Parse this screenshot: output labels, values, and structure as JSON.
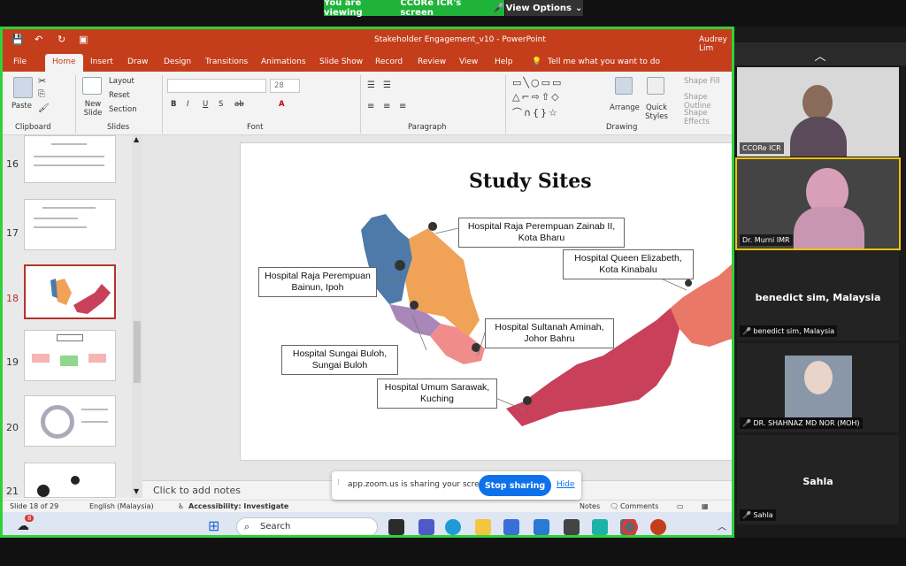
{
  "zoom": {
    "viewing_text": "You are viewing",
    "viewing_name": "CCORe ICR's screen",
    "view_options": "View Options",
    "share_msg": "app.zoom.us is sharing your screen.",
    "stop_label": "Stop sharing",
    "hide_label": "Hide"
  },
  "ppt": {
    "title": "Stakeholder Engagement_v10  -  PowerPoint",
    "user": "Audrey Lim",
    "tabs": [
      "File",
      "Home",
      "Insert",
      "Draw",
      "Design",
      "Transitions",
      "Animations",
      "Slide Show",
      "Record",
      "Review",
      "View",
      "Help"
    ],
    "tell_me": "Tell me what you want to do",
    "ribbon": {
      "paste": "Paste",
      "new_slide": "New Slide",
      "layout": "Layout",
      "reset": "Reset",
      "section": "Section",
      "font_size": "28",
      "arrange": "Arrange",
      "quick_styles": "Quick Styles",
      "shape_fill": "Shape Fill",
      "shape_outline": "Shape Outline",
      "shape_effects": "Shape Effects",
      "groups": [
        "Clipboard",
        "Slides",
        "Font",
        "Paragraph",
        "Drawing"
      ]
    },
    "thumb_numbers": [
      "16",
      "17",
      "18",
      "19",
      "20",
      "21"
    ],
    "slide": {
      "title": "Study Sites",
      "labels": {
        "zainab": "Hospital Raja Perempuan Zainab II, Kota Bharu",
        "bainun": "Hospital Raja Perempuan Bainun, Ipoh",
        "queen": "Hospital Queen Elizabeth, Kota Kinabalu",
        "aminah": "Hospital Sultanah Aminah, Johor Bahru",
        "buloh": "Hospital Sungai Buloh, Sungai Buloh",
        "sarawak": "Hospital Umum Sarawak, Kuching"
      }
    },
    "notes_placeholder": "Click to add notes",
    "status": {
      "slide": "Slide 18 of 29",
      "language": "English (Malaysia)",
      "accessibility": "Accessibility: Investigate",
      "notes": "Notes",
      "comments": "Comments"
    }
  },
  "taskbar": {
    "search": "Search",
    "badge": "8"
  },
  "participants": [
    {
      "name": "CCORe ICR"
    },
    {
      "name": "Dr. Murni IMR"
    },
    {
      "name": "benedict sim, Malaysia"
    },
    {
      "name": "DR. SHAHNAZ MD NOR (MOH)"
    },
    {
      "name": "Sahla"
    }
  ],
  "colors": {
    "ppt_red": "#c43e1c",
    "zoom_green": "#1fb33a",
    "zoom_blue": "#0e71eb",
    "map_blue": "#4d7aa8",
    "map_orange": "#f0a257",
    "map_purple": "#a987b8",
    "map_pink": "#f08d8a",
    "map_rose": "#c9405a",
    "map_salmon": "#ea7868"
  }
}
